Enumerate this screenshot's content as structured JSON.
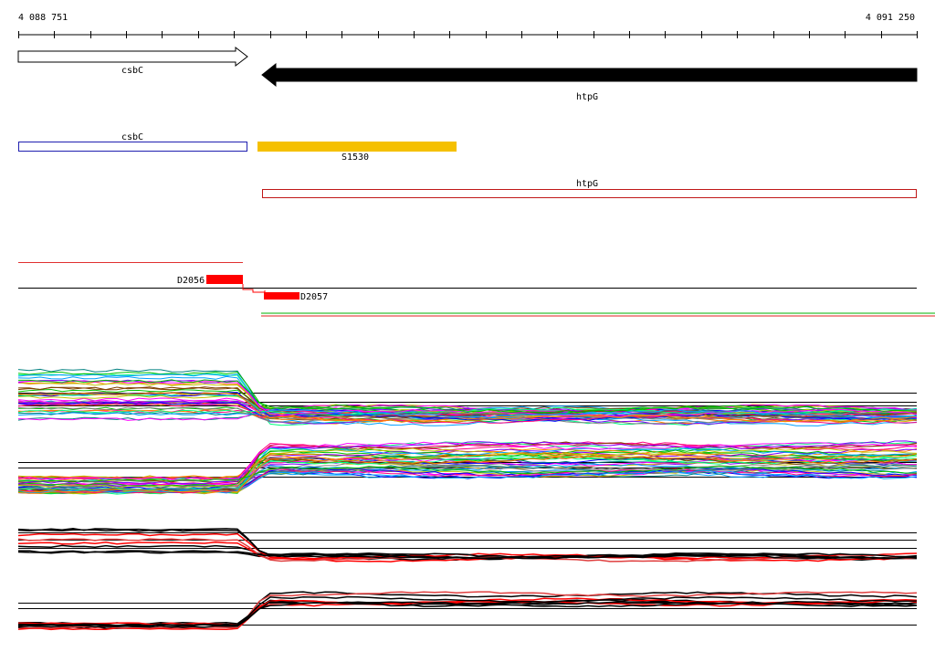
{
  "coordinates": {
    "start": "4 088 751",
    "end": "4 091 250"
  },
  "annotations": {
    "genes": [
      {
        "name": "csbC",
        "strand": "+",
        "style": "open"
      },
      {
        "name": "htpG",
        "strand": "-",
        "style": "filled"
      }
    ],
    "features": [
      {
        "name": "csbC",
        "color": "#1f1fb0"
      },
      {
        "name": "S1530",
        "color": "#f5c000"
      },
      {
        "name": "htpG",
        "color": "#c01818"
      }
    ],
    "probes": [
      {
        "name": "D2056",
        "color": "#ff0000"
      },
      {
        "name": "D2057",
        "color": "#ff0000"
      }
    ]
  },
  "expression_panels": [
    {
      "id": "panel-1",
      "trend": "high-then-drop"
    },
    {
      "id": "panel-2",
      "trend": "low-then-rise"
    },
    {
      "id": "panel-3",
      "trend": "high-then-drop"
    },
    {
      "id": "panel-4",
      "trend": "low-then-rise"
    }
  ],
  "colors": {
    "accent_red": "#ff0000",
    "feature_orange": "#f5c000",
    "feature_blue": "#1f1fb0",
    "feature_red": "#c01818",
    "trace_palette": [
      "#ff00ff",
      "#00c000",
      "#00a0ff",
      "#ff8000",
      "#8000ff",
      "#008080",
      "#c0c000",
      "#0000ff",
      "#ff0080",
      "#804000",
      "#00ff80",
      "#808080"
    ]
  }
}
